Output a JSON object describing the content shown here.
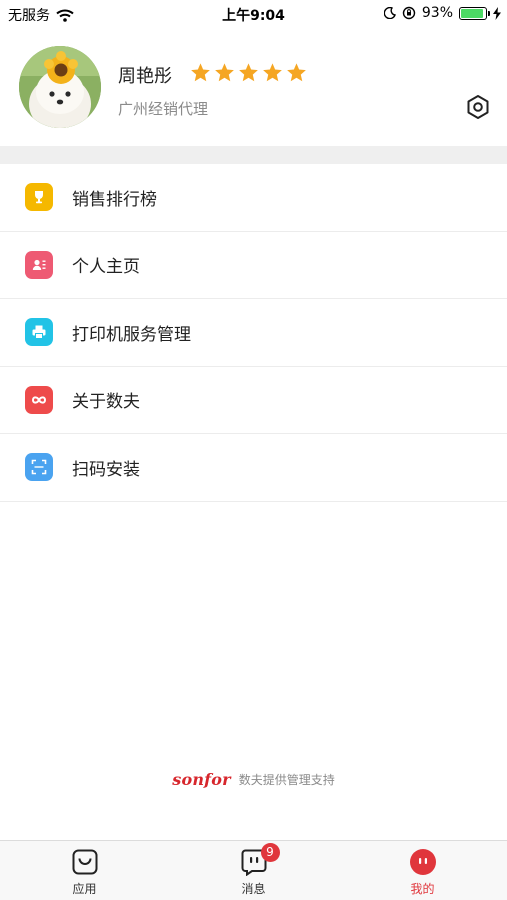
{
  "status_bar": {
    "carrier": "无服务",
    "time": "上午9:04",
    "battery_percent": "93%",
    "battery_level": 0.93
  },
  "profile": {
    "name": "周艳彤",
    "rating_stars": 5,
    "role": "广州经销代理"
  },
  "menu": [
    {
      "label": "销售排行榜",
      "icon": "trophy-icon",
      "color": "#f5b800"
    },
    {
      "label": "个人主页",
      "icon": "contact-card-icon",
      "color": "#ee5a73"
    },
    {
      "label": "打印机服务管理",
      "icon": "printer-icon",
      "color": "#22c3e6"
    },
    {
      "label": "关于数夫",
      "icon": "infinity-icon",
      "color": "#ee4b4b"
    },
    {
      "label": "扫码安装",
      "icon": "scan-icon",
      "color": "#4aa3f0"
    }
  ],
  "footer": {
    "brand": "sonfor",
    "support_text": "数夫提供管理支持"
  },
  "tabs": [
    {
      "label": "应用",
      "icon": "shopping-bag-icon",
      "active": false
    },
    {
      "label": "消息",
      "icon": "message-icon",
      "badge": "9",
      "active": false
    },
    {
      "label": "我的",
      "icon": "me-face-icon",
      "active": true
    }
  ],
  "colors": {
    "accent": "#e0363c",
    "star": "#f5a623"
  }
}
